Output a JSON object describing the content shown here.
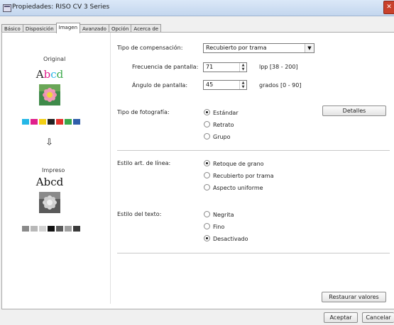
{
  "window": {
    "title": "Propiedades: RISO CV 3 Series"
  },
  "tabs": [
    {
      "label": "Básico"
    },
    {
      "label": "Disposición"
    },
    {
      "label": "Imagen",
      "active": true
    },
    {
      "label": "Avanzado"
    },
    {
      "label": "Opción"
    },
    {
      "label": "Acerca de"
    }
  ],
  "preview": {
    "original_label": "Original",
    "impreso_label": "Impreso",
    "sample_text": "Abcd",
    "original_swatches": [
      "#25b7e6",
      "#e0208c",
      "#f2cf16",
      "#222222",
      "#e4312d",
      "#3aa84a",
      "#2f5eaa"
    ],
    "impreso_swatches": [
      "#8a8a8a",
      "#b8b8b8",
      "#d2d2d2",
      "#111111",
      "#5a5a5a",
      "#a0a0a0",
      "#3a3a3a"
    ]
  },
  "compensation": {
    "label": "Tipo de compensación:",
    "value": "Recubierto por trama",
    "frequency_label": "Frecuencia de pantalla:",
    "frequency_value": "71",
    "frequency_unit": "lpp [38 - 200]",
    "angle_label": "Ángulo de pantalla:",
    "angle_value": "45",
    "angle_unit": "grados [0 - 90]"
  },
  "photo_type": {
    "label": "Tipo de fotografía:",
    "options": [
      "Estándar",
      "Retrato",
      "Grupo"
    ],
    "selected": 0,
    "details_button": "Detalles"
  },
  "line_art": {
    "label": "Estilo art. de línea:",
    "options": [
      "Retoque de grano",
      "Recubierto por trama",
      "Aspecto uniforme"
    ],
    "selected": 0
  },
  "text_style": {
    "label": "Estilo del texto:",
    "options": [
      "Negrita",
      "Fino",
      "Desactivado"
    ],
    "selected": 2
  },
  "buttons": {
    "restore": "Restaurar valores",
    "accept": "Aceptar",
    "cancel": "Cancelar"
  }
}
